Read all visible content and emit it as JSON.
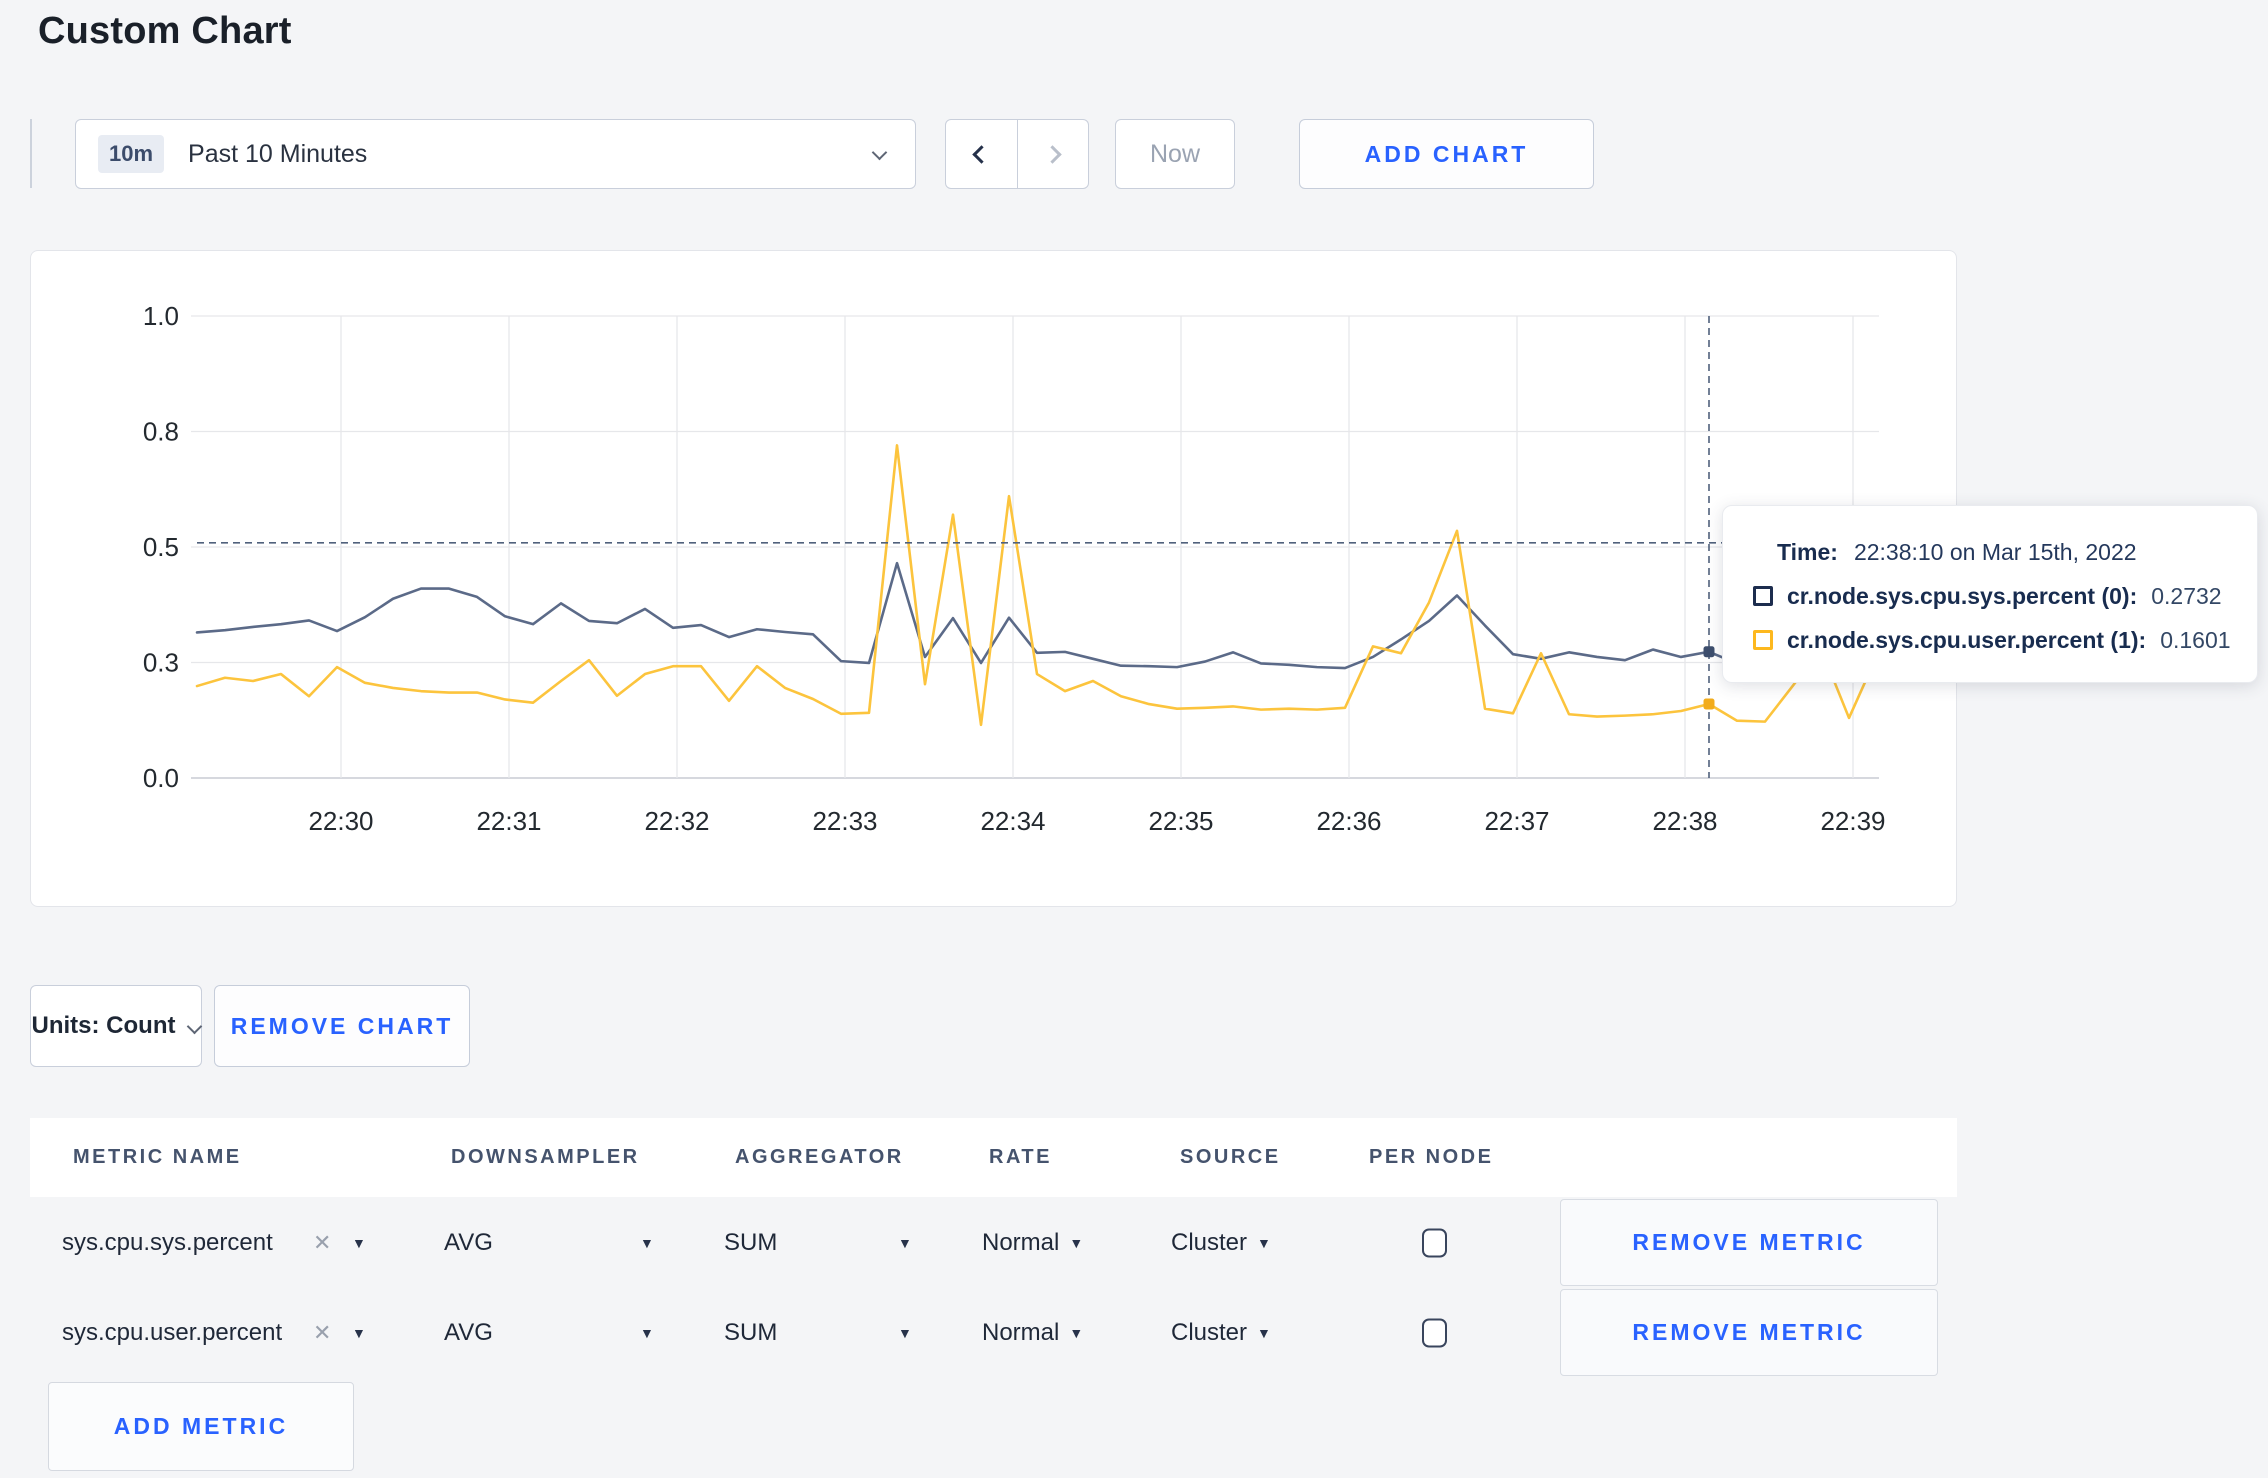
{
  "page": {
    "title": "Custom Chart",
    "background": "#f4f5f7"
  },
  "toolbar": {
    "time_range": {
      "badge": "10m",
      "label": "Past 10 Minutes"
    },
    "now_label": "Now",
    "add_chart_label": "ADD CHART"
  },
  "chart_data": {
    "type": "line",
    "title": "",
    "xlabel": "",
    "ylabel": "",
    "ylim": [
      0,
      1
    ],
    "grid": true,
    "legend_position": "tooltip",
    "x_tick_labels": [
      "22:30",
      "22:31",
      "22:32",
      "22:33",
      "22:34",
      "22:35",
      "22:36",
      "22:37",
      "22:38",
      "22:39"
    ],
    "y_tick_labels": [
      "0.0",
      "0.3",
      "0.5",
      "0.8",
      "1.0"
    ],
    "y_tick_values": [
      0,
      0.25,
      0.5,
      0.75,
      1.0
    ],
    "x_start": "22:29:10",
    "x_step_seconds": 10,
    "series": [
      {
        "name": "cr.node.sys.cpu.sys.percent (0)",
        "color": "#5b6a88",
        "dot_color": "#3d4e6d",
        "values": [
          0.315,
          0.32,
          0.327,
          0.333,
          0.341,
          0.318,
          0.348,
          0.388,
          0.41,
          0.41,
          0.392,
          0.35,
          0.333,
          0.378,
          0.34,
          0.335,
          0.366,
          0.325,
          0.331,
          0.305,
          0.322,
          0.316,
          0.311,
          0.253,
          0.249,
          0.465,
          0.262,
          0.346,
          0.249,
          0.347,
          0.271,
          0.273,
          0.258,
          0.243,
          0.242,
          0.24,
          0.252,
          0.272,
          0.248,
          0.245,
          0.24,
          0.238,
          0.262,
          0.3,
          0.34,
          0.395,
          0.33,
          0.268,
          0.258,
          0.272,
          0.262,
          0.255,
          0.278,
          0.262,
          0.2732,
          0.248,
          0.252,
          0.255,
          0.257,
          0.252,
          0.27
        ]
      },
      {
        "name": "cr.node.sys.cpu.user.percent (1)",
        "color": "#fcc43d",
        "dot_color": "#f2ac1c",
        "values": [
          0.199,
          0.217,
          0.21,
          0.225,
          0.177,
          0.24,
          0.206,
          0.195,
          0.188,
          0.185,
          0.185,
          0.17,
          0.163,
          0.21,
          0.255,
          0.178,
          0.225,
          0.242,
          0.242,
          0.167,
          0.242,
          0.195,
          0.171,
          0.139,
          0.141,
          0.72,
          0.203,
          0.57,
          0.115,
          0.61,
          0.225,
          0.188,
          0.21,
          0.177,
          0.16,
          0.15,
          0.152,
          0.155,
          0.148,
          0.15,
          0.148,
          0.152,
          0.285,
          0.27,
          0.38,
          0.535,
          0.15,
          0.14,
          0.27,
          0.138,
          0.133,
          0.135,
          0.138,
          0.145,
          0.1601,
          0.124,
          0.122,
          0.2,
          0.28,
          0.13,
          0.265
        ]
      }
    ],
    "crosshair": {
      "x_index": 54,
      "x_time": "22:38:10",
      "y_value": 0.509
    }
  },
  "tooltip": {
    "time_label": "Time:",
    "time_value": "22:38:10 on Mar 15th, 2022",
    "rows": [
      {
        "label": "cr.node.sys.cpu.sys.percent (0):",
        "value": "0.2732",
        "color": "#1d2d4e"
      },
      {
        "label": "cr.node.sys.cpu.user.percent (1):",
        "value": "0.1601",
        "color": "#fdb81e"
      }
    ]
  },
  "chart_controls": {
    "units_label": "Units: Count",
    "remove_chart_label": "REMOVE CHART"
  },
  "metrics_table": {
    "headers": [
      "METRIC NAME",
      "DOWNSAMPLER",
      "AGGREGATOR",
      "RATE",
      "SOURCE",
      "PER NODE"
    ],
    "rows": [
      {
        "metric": "sys.cpu.sys.percent",
        "remove_icon": "✕",
        "downsampler": "AVG",
        "aggregator": "SUM",
        "rate": "Normal",
        "source": "Cluster",
        "per_node_checked": false,
        "remove_label": "REMOVE METRIC"
      },
      {
        "metric": "sys.cpu.user.percent",
        "remove_icon": "✕",
        "downsampler": "AVG",
        "aggregator": "SUM",
        "rate": "Normal",
        "source": "Cluster",
        "per_node_checked": false,
        "remove_label": "REMOVE METRIC"
      }
    ],
    "add_metric_label": "ADD METRIC"
  },
  "colors": {
    "accent_blue": "#2962ff",
    "grid_line": "#e6e7ea",
    "axis_line": "#c8ccd3",
    "tick_text": "#23292f",
    "crosshair": "#50617c"
  }
}
